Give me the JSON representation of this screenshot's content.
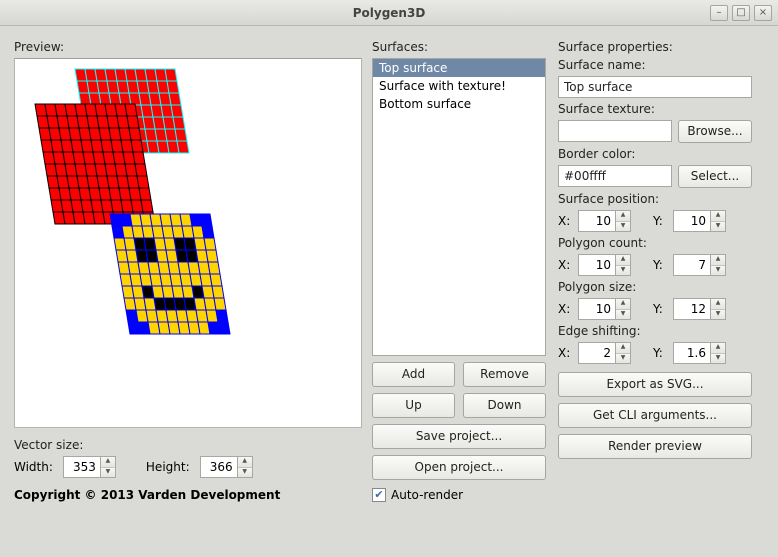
{
  "window": {
    "title": "Polygen3D"
  },
  "preview": {
    "label": "Preview:"
  },
  "vector_size": {
    "label": "Vector size:",
    "width_label": "Width:",
    "width": "353",
    "height_label": "Height:",
    "height": "366"
  },
  "footer": "Copyright © 2013 Varden Development",
  "surfaces": {
    "label": "Surfaces:",
    "items": [
      "Top surface",
      "Surface with texture!",
      "Bottom surface"
    ],
    "selected_index": 0,
    "add": "Add",
    "remove": "Remove",
    "up": "Up",
    "down": "Down",
    "save_project": "Save project...",
    "open_project": "Open project...",
    "auto_render": "Auto-render",
    "auto_render_checked": true
  },
  "props": {
    "label": "Surface properties:",
    "name_label": "Surface name:",
    "name": "Top surface",
    "texture_label": "Surface texture:",
    "texture": "",
    "browse": "Browse...",
    "border_label": "Border color:",
    "border": "#00ffff",
    "select": "Select...",
    "position_label": "Surface position:",
    "position": {
      "x_label": "X:",
      "x": "10",
      "y_label": "Y:",
      "y": "10"
    },
    "count_label": "Polygon count:",
    "count": {
      "x_label": "X:",
      "x": "10",
      "y_label": "Y:",
      "y": "7"
    },
    "size_label": "Polygon size:",
    "size": {
      "x_label": "X:",
      "x": "10",
      "y_label": "Y:",
      "y": "12"
    },
    "shift_label": "Edge shifting:",
    "shift": {
      "x_label": "X:",
      "x": "2",
      "y_label": "Y:",
      "y": "1.6"
    },
    "export_svg": "Export as SVG...",
    "cli_args": "Get CLI arguments...",
    "render": "Render preview"
  }
}
